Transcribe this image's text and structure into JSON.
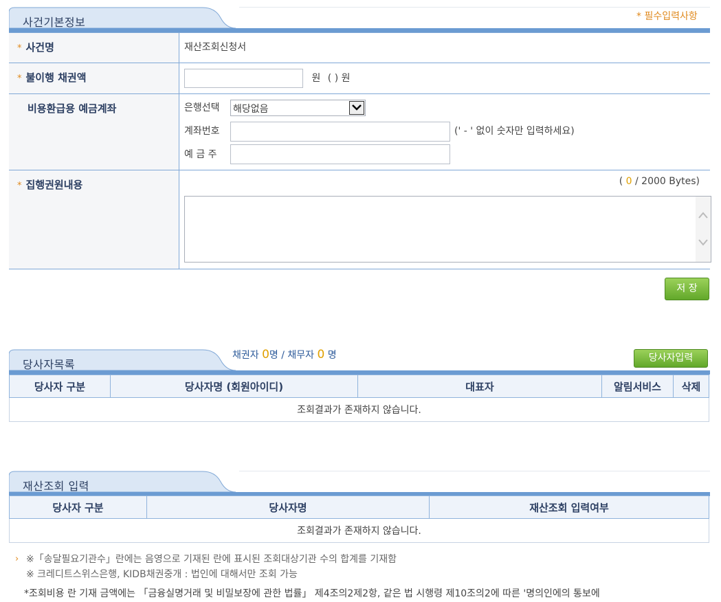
{
  "case_info": {
    "title": "사건기본정보",
    "required_note": "* 필수입력사항",
    "case_name_label": "사건명",
    "case_name_value": "재산조회신청서",
    "debt_label": "불이행 채권액",
    "debt_unit": "원",
    "debt_paren": "( ) 원",
    "account_label": "비용환급용 예금계좌",
    "bank_label": "은행선택",
    "bank_selected": "해당없음",
    "account_no_label": "계좌번호",
    "account_hint": "(' - ' 없이 숫자만 입력하세요)",
    "depositor_label": "예 금 주",
    "exec_label": "집행권원내용",
    "byte_open": "(",
    "byte_count": "0",
    "byte_rest": "/ 2000 Bytes)",
    "save_label": "저 장",
    "star": "*"
  },
  "parties": {
    "title": "당사자목록",
    "creditor_label": "채권자",
    "creditor_count": "0",
    "debtor_label": "명 / 채무자",
    "debtor_count": "0",
    "count_suffix": "명",
    "add_button": "당사자입력",
    "columns": [
      "당사자 구분",
      "당사자명 (회원아이디)",
      "대표자",
      "알림서비스",
      "삭제"
    ],
    "empty": "조회결과가 존재하지 않습니다."
  },
  "asset_query": {
    "title": "재산조회 입력",
    "columns": [
      "당사자 구분",
      "당사자명",
      "재산조회 입력여부"
    ],
    "empty": "조회결과가 존재하지 않습니다."
  },
  "notes": {
    "line1": "※「송달필요기관수」란에는 음영으로 기재된 란에 표시된 조회대상기관 수의 합계를 기재함",
    "line2": "※ 크레디트스위스은행, KIDB채권중개 : 법인에 대해서만 조회 가능",
    "line3": "*조회비용 란 기재 금액에는 「금융실명거래 및 비밀보장에 관한 법률」 제4조의2제2항, 같은 법 시행령 제10조의2에 따른 '명의인에의 통보에"
  },
  "colors": {
    "accent": "#6b9bd2",
    "required": "#e08a1e",
    "button": "#6fb531"
  }
}
